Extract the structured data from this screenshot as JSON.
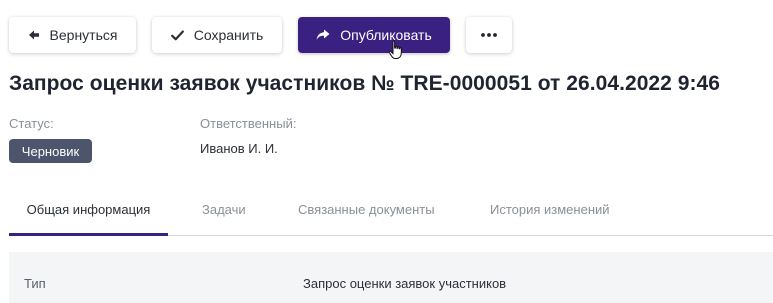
{
  "toolbar": {
    "back_label": "Вернуться",
    "save_label": "Сохранить",
    "publish_label": "Опубликовать",
    "more_icon": "more-horizontal-icon"
  },
  "header": {
    "title": "Запрос оценки заявок участников № TRE-0000051 от 26.04.2022 9:46"
  },
  "fields": {
    "status_label": "Статус:",
    "status_value": "Черновик",
    "owner_label": "Ответственный:",
    "owner_value": "Иванов И. И."
  },
  "tabs": [
    {
      "label": "Общая информация",
      "active": true
    },
    {
      "label": "Задачи",
      "active": false
    },
    {
      "label": "Связанные документы",
      "active": false
    },
    {
      "label": "История изменений",
      "active": false
    }
  ],
  "info": {
    "rows": [
      {
        "key": "Тип",
        "value": "Запрос оценки заявок участников"
      }
    ]
  },
  "colors": {
    "accent": "#3a2080",
    "badge": "#4c556b",
    "panel": "#f4f5f7"
  }
}
